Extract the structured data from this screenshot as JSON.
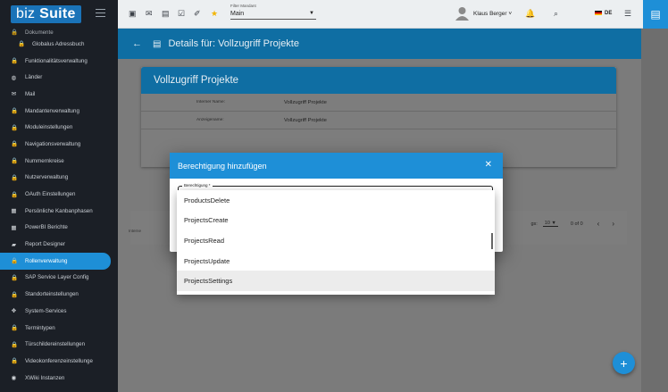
{
  "app": {
    "logo_light": "biz",
    "logo_bold": "Suite"
  },
  "sidebar": {
    "top_item": "Dokumente",
    "items": [
      {
        "label": "Globalus Adressbuch",
        "icon": "lock-icon",
        "glyph": "🔒",
        "sub": true
      },
      {
        "label": "Funktionalitätsverwaltung",
        "icon": "lock-icon",
        "glyph": "🔒"
      },
      {
        "label": "Länder",
        "icon": "globe-icon",
        "glyph": "◍"
      },
      {
        "label": "Mail",
        "icon": "mail-icon",
        "glyph": "✉"
      },
      {
        "label": "Mandantenverwaltung",
        "icon": "lock-icon",
        "glyph": "🔒"
      },
      {
        "label": "Moduleinstellungen",
        "icon": "lock-icon",
        "glyph": "🔒"
      },
      {
        "label": "Navigationsverwaltung",
        "icon": "lock-icon",
        "glyph": "🔒"
      },
      {
        "label": "Nummernkreise",
        "icon": "lock-icon",
        "glyph": "🔒"
      },
      {
        "label": "Nutzerverwaltung",
        "icon": "lock-icon",
        "glyph": "🔒"
      },
      {
        "label": "OAuth Einstellungen",
        "icon": "lock-icon",
        "glyph": "🔒"
      },
      {
        "label": "Persönliche Kanbanphasen",
        "icon": "kanban-icon",
        "glyph": "▦"
      },
      {
        "label": "PowerBI Berichte",
        "icon": "chart-icon",
        "glyph": "▦"
      },
      {
        "label": "Report Designer",
        "icon": "folder-icon",
        "glyph": "▰"
      },
      {
        "label": "Rollenverwaltung",
        "icon": "lock-icon",
        "glyph": "🔒",
        "active": true
      },
      {
        "label": "SAP Service Layer Config",
        "icon": "lock-icon",
        "glyph": "🔒"
      },
      {
        "label": "Standorteinstellungen",
        "icon": "lock-icon",
        "glyph": "🔒"
      },
      {
        "label": "System-Services",
        "icon": "services-icon",
        "glyph": "✥"
      },
      {
        "label": "Termintypen",
        "icon": "lock-icon",
        "glyph": "🔒"
      },
      {
        "label": "Türschildereinstellungen",
        "icon": "lock-icon",
        "glyph": "🔒"
      },
      {
        "label": "Videokonferenzeinstellunge",
        "icon": "lock-icon",
        "glyph": "🔒"
      },
      {
        "label": "XWiki Instanzen",
        "icon": "wiki-icon",
        "glyph": "◉"
      }
    ]
  },
  "topbar": {
    "filter_label": "Filter Mandant",
    "filter_value": "Main",
    "user_name": "Klaus Berger",
    "language": "DE"
  },
  "page": {
    "title": "Details für: Vollzugriff Projekte",
    "card_title": "Vollzugriff Projekte",
    "rows": [
      {
        "key": "Interner Name:",
        "value": "Vollzugriff Projekte"
      },
      {
        "key": "Anzeigename:",
        "value": "Vollzugriff Projekte"
      }
    ],
    "pager_label": "gs:",
    "pager_size": "10",
    "pager_range": "0 of 0",
    "internal_label": "Interne"
  },
  "dialog": {
    "title": "Berechtigung hinzufügen",
    "field_label": "Berechtigung *",
    "options": [
      "ProductsDelete",
      "ProjectsCreate",
      "ProjectsRead",
      "ProjectsUpdate",
      "ProjectsSettings"
    ],
    "hovered_index": 4
  },
  "colors": {
    "accent": "#1e8fd7",
    "sidebar_bg": "#1b1f26",
    "star": "#f2b400"
  }
}
